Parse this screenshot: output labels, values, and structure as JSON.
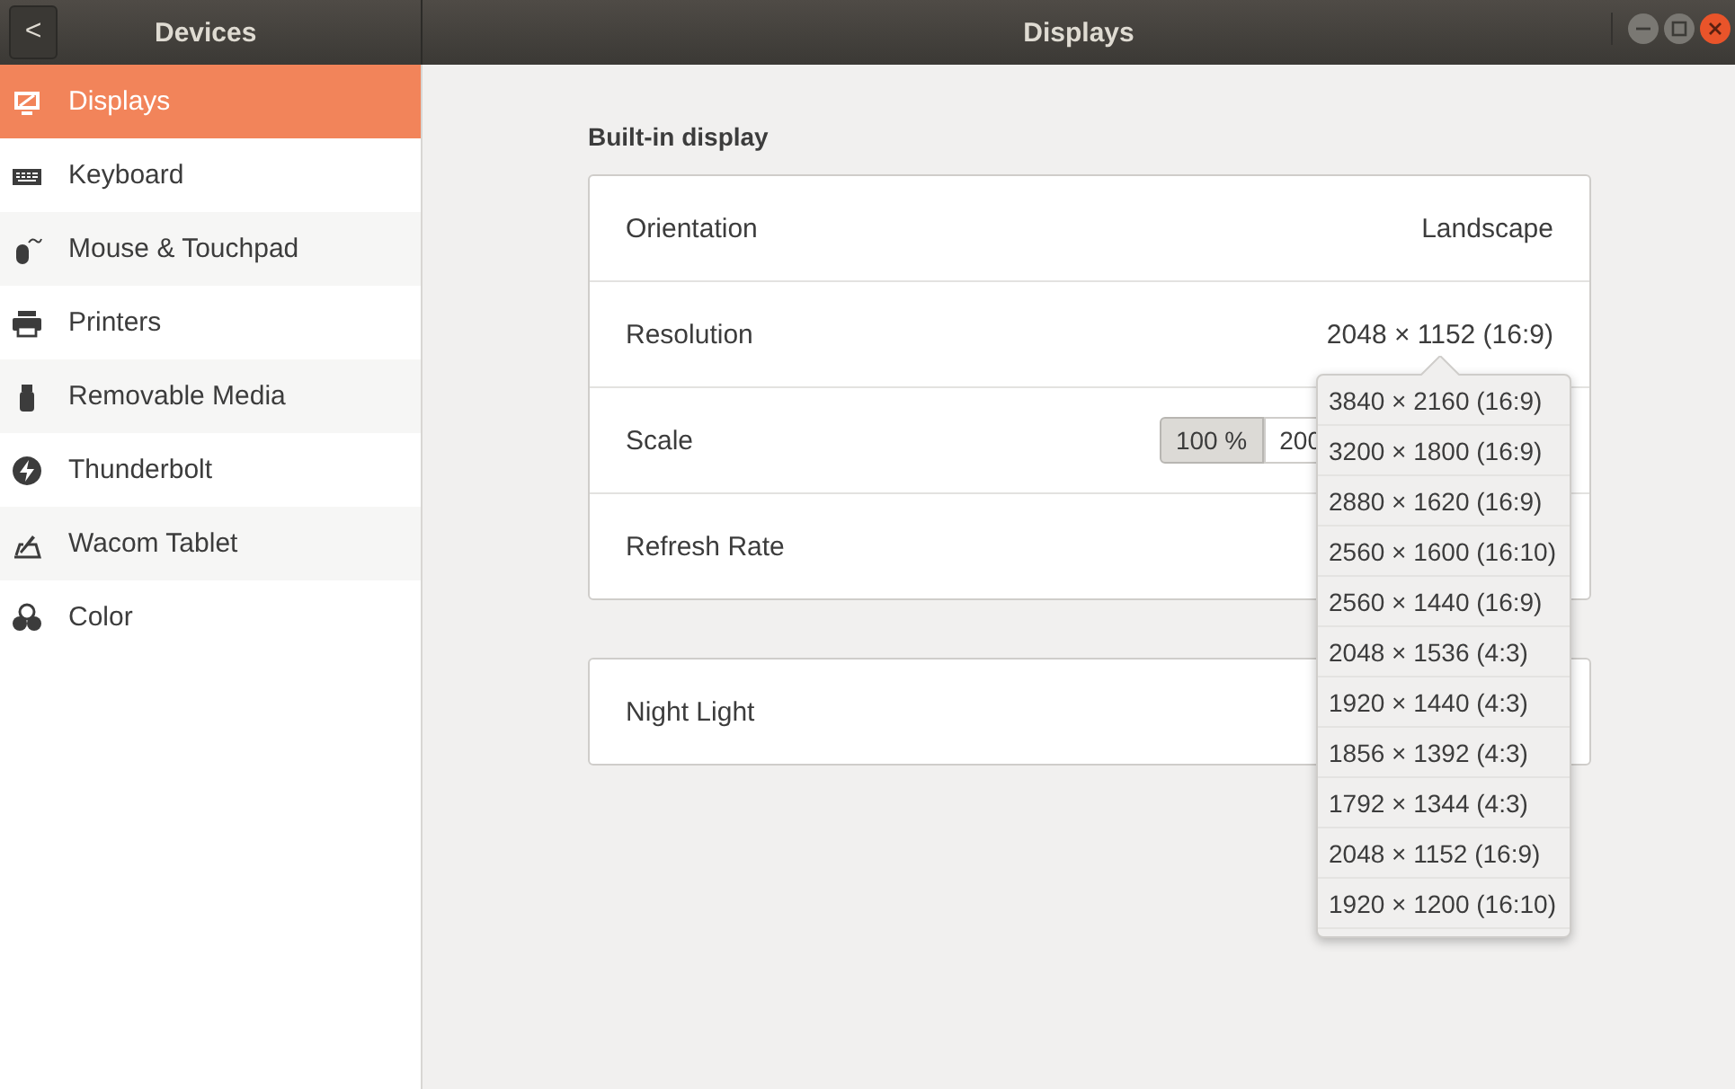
{
  "header": {
    "back": "<",
    "sidebar_title": "Devices",
    "title": "Displays"
  },
  "sidebar": {
    "items": [
      {
        "label": "Displays",
        "kind": "display",
        "selected": true
      },
      {
        "label": "Keyboard",
        "kind": "keyboard",
        "selected": false
      },
      {
        "label": "Mouse & Touchpad",
        "kind": "mouse",
        "selected": false
      },
      {
        "label": "Printers",
        "kind": "printer",
        "selected": false
      },
      {
        "label": "Removable Media",
        "kind": "usb",
        "selected": false
      },
      {
        "label": "Thunderbolt",
        "kind": "bolt",
        "selected": false
      },
      {
        "label": "Wacom Tablet",
        "kind": "tablet",
        "selected": false
      },
      {
        "label": "Color",
        "kind": "color",
        "selected": false
      }
    ]
  },
  "section_title": "Built-in display",
  "settings": [
    {
      "label": "Orientation",
      "kind": "value",
      "value": "Landscape"
    },
    {
      "label": "Resolution",
      "kind": "value",
      "value": "2048 × 1152 (16:9)"
    },
    {
      "label": "Scale",
      "kind": "scale",
      "options": [
        {
          "label": "100 %",
          "selected": true
        },
        {
          "label": "200",
          "selected": false
        }
      ]
    },
    {
      "label": "Refresh Rate",
      "kind": "empty"
    }
  ],
  "night_light": {
    "label": "Night Light"
  },
  "resolution_menu": {
    "items": [
      "3840 × 2160 (16:9)",
      "3200 × 1800 (16:9)",
      "2880 × 1620 (16:9)",
      "2560 × 1600 (16:10)",
      "2560 × 1440 (16:9)",
      "2048 × 1536 (4:3)",
      "1920 × 1440 (4:3)",
      "1856 × 1392 (4:3)",
      "1792 × 1344 (4:3)",
      "2048 × 1152 (16:9)",
      "1920 × 1200 (16:10)"
    ]
  }
}
